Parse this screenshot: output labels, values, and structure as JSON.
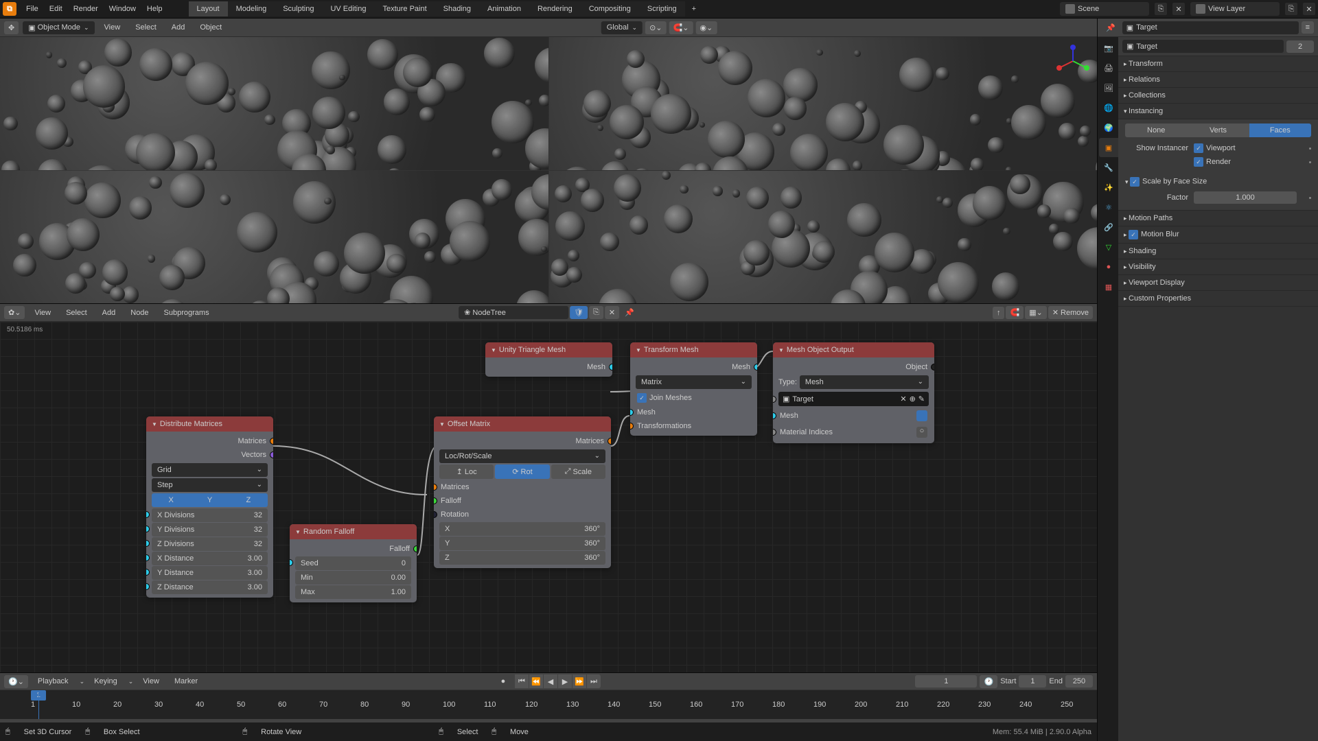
{
  "menu": {
    "file": "File",
    "edit": "Edit",
    "render": "Render",
    "window": "Window",
    "help": "Help"
  },
  "tabs": [
    "Layout",
    "Modeling",
    "Sculpting",
    "UV Editing",
    "Texture Paint",
    "Shading",
    "Animation",
    "Rendering",
    "Compositing",
    "Scripting"
  ],
  "scene": "Scene",
  "view_layer": "View Layer",
  "toolbar_main": {
    "mode": "Object Mode",
    "view": "View",
    "select": "Select",
    "add": "Add",
    "object": "Object",
    "orient": "Global"
  },
  "toolbar_right": {
    "pin": "Target"
  },
  "node_header": {
    "view": "View",
    "select": "Select",
    "add": "Add",
    "node": "Node",
    "subprograms": "Subprograms",
    "tree": "NodeTree",
    "remove": "Remove"
  },
  "perf": "50.5186 ms",
  "nodes": {
    "dist": {
      "title": "Distribute Matrices",
      "matrices": "Matrices",
      "vectors": "Vectors",
      "type": "Grid",
      "step": "Step",
      "x": "X",
      "y": "Y",
      "z": "Z",
      "xdiv_l": "X Divisions",
      "xdiv_v": "32",
      "ydiv_l": "Y Divisions",
      "ydiv_v": "32",
      "zdiv_l": "Z Divisions",
      "zdiv_v": "32",
      "xdist_l": "X Distance",
      "xdist_v": "3.00",
      "ydist_l": "Y Distance",
      "ydist_v": "3.00",
      "zdist_l": "Z Distance",
      "zdist_v": "3.00"
    },
    "falloff": {
      "title": "Random Falloff",
      "falloff": "Falloff",
      "seed_l": "Seed",
      "seed_v": "0",
      "min_l": "Min",
      "min_v": "0.00",
      "max_l": "Max",
      "max_v": "1.00"
    },
    "offset": {
      "title": "Offset Matrix",
      "matrices": "Matrices",
      "lrs": "Loc/Rot/Scale",
      "loc": "Loc",
      "rot": "Rot",
      "scale": "Scale",
      "matrices_in": "Matrices",
      "falloff": "Falloff",
      "rotation": "Rotation",
      "x_l": "X",
      "x_v": "360°",
      "y_l": "Y",
      "y_v": "360°",
      "z_l": "Z",
      "z_v": "360°"
    },
    "unity": {
      "title": "Unity Triangle Mesh",
      "mesh": "Mesh"
    },
    "transform": {
      "title": "Transform Mesh",
      "mesh": "Mesh",
      "matrix": "Matrix",
      "join_l": "Join Meshes",
      "mesh_in": "Mesh",
      "trans": "Transformations"
    },
    "output": {
      "title": "Mesh Object Output",
      "object": "Object",
      "type_l": "Type:",
      "type_v": "Mesh",
      "target": "Target",
      "mesh": "Mesh",
      "mat": "Material Indices"
    }
  },
  "timeline": {
    "playback": "Playback",
    "keying": "Keying",
    "view": "View",
    "marker": "Marker",
    "frame": "1",
    "start_l": "Start",
    "start_v": "1",
    "end_l": "End",
    "end_v": "250",
    "cur": "1"
  },
  "ticks": [
    "1",
    "10",
    "20",
    "30",
    "40",
    "50",
    "60",
    "70",
    "80",
    "90",
    "100",
    "110",
    "120",
    "130",
    "140",
    "150",
    "160",
    "170",
    "180",
    "190",
    "200",
    "210",
    "220",
    "230",
    "240",
    "250"
  ],
  "status": {
    "cursor": "Set 3D Cursor",
    "box": "Box Select",
    "rotate": "Rotate View",
    "select": "Select",
    "move": "Move",
    "mem": "Mem: 55.4 MiB | 2.90.0 Alpha"
  },
  "props": {
    "obj": "Target",
    "users": "2",
    "sections": {
      "transform": "Transform",
      "relations": "Relations",
      "collections": "Collections",
      "instancing": "Instancing",
      "motion_paths": "Motion Paths",
      "motion_blur": "Motion Blur",
      "shading": "Shading",
      "visibility": "Visibility",
      "viewport": "Viewport Display",
      "custom": "Custom Properties"
    },
    "inst": {
      "none": "None",
      "verts": "Verts",
      "faces": "Faces",
      "show_l": "Show Instancer",
      "viewport": "Viewport",
      "render": "Render",
      "scale_l": "Scale by Face Size",
      "factor_l": "Factor",
      "factor_v": "1.000"
    }
  }
}
